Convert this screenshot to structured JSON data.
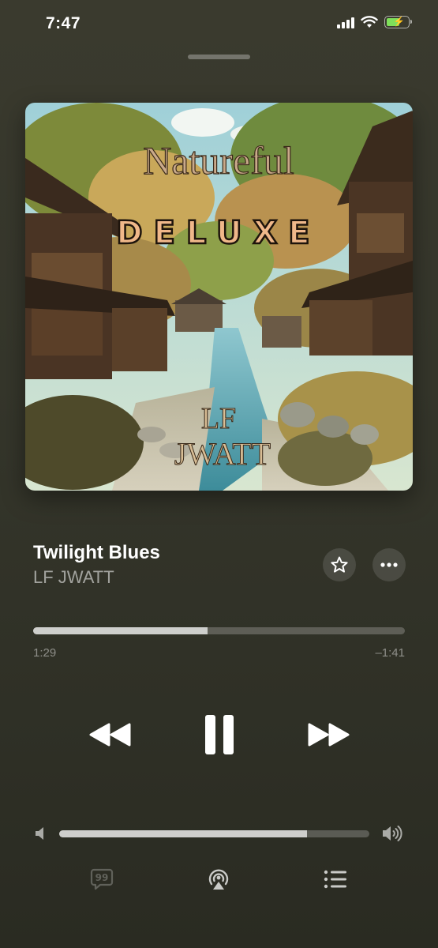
{
  "status_bar": {
    "time": "7:47",
    "signal_icon": "cellular-signal-icon",
    "wifi_icon": "wifi-icon",
    "battery_icon": "battery-charging-icon",
    "battery_level": 0.6
  },
  "artwork": {
    "title_text": "Natureful",
    "edition_text": "DELUXE",
    "artist_line1": "LF",
    "artist_line2": "JWATT"
  },
  "track": {
    "title": "Twilight Blues",
    "artist": "LF JWATT"
  },
  "actions": {
    "favorite_icon": "star-icon",
    "more_icon": "ellipsis-icon"
  },
  "progress": {
    "elapsed": "1:29",
    "remaining": "–1:41",
    "fraction": 0.47
  },
  "controls": {
    "rewind_icon": "rewind-icon",
    "pause_icon": "pause-icon",
    "forward_icon": "fast-forward-icon"
  },
  "volume": {
    "low_icon": "speaker-low-icon",
    "high_icon": "speaker-high-icon",
    "level": 0.8
  },
  "bottom_bar": {
    "lyrics_icon": "lyrics-quote-icon",
    "airplay_icon": "airplay-icon",
    "queue_icon": "queue-list-icon"
  },
  "colors": {
    "battery_green": "#7fe05a",
    "background": "#35362b"
  }
}
